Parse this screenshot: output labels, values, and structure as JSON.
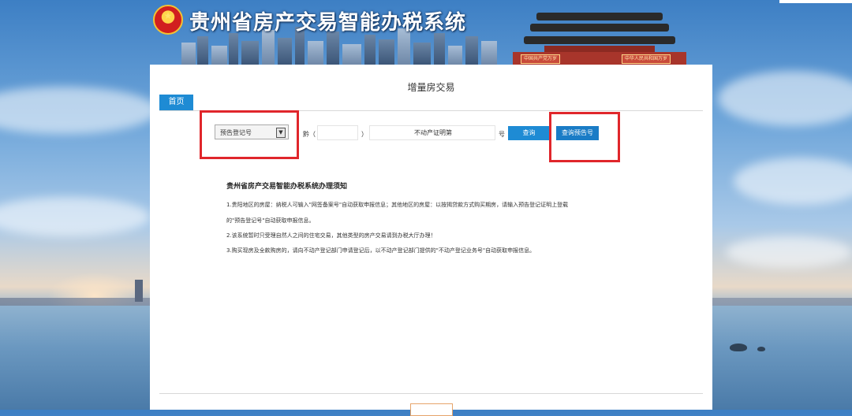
{
  "header": {
    "site_title": "贵州省房产交易智能办税系统",
    "gate_sign_left": "中国共产党万岁",
    "gate_sign_right": "中华人民共和国万岁"
  },
  "page": {
    "heading": "增量房交易",
    "tabs": [
      {
        "label": "首页"
      }
    ]
  },
  "search": {
    "select_value": "预告登记号",
    "prefix_char": "黔（",
    "paren_close": "）",
    "cert_value": "不动产证明第",
    "suffix_char": "号",
    "query_button": "查询",
    "prereg_button": "查询预告号"
  },
  "notice": {
    "title": "贵州省房产交易智能办税系统办理须知",
    "lines": [
      "1.贵阳地区的房屋：纳税人可输入\"网签备案号\"自动获取申报信息；其他地区的房屋：以按揭贷款方式购买期房，请输入预告登记证明上登载",
      "的\"预告登记号\"自动获取申报信息。",
      "2.该系统暂时只受理自然人之间的住宅交易，其他类型的房产交易请到办税大厅办理！",
      "3.购买现房及全款购房的，请向不动产登记部门申请登记后，以不动产登记部门提供的\"不动产登记业务号\"自动获取申报信息。"
    ]
  },
  "colors": {
    "accent_blue": "#1e8bd4",
    "highlight_red": "#e0262b"
  }
}
